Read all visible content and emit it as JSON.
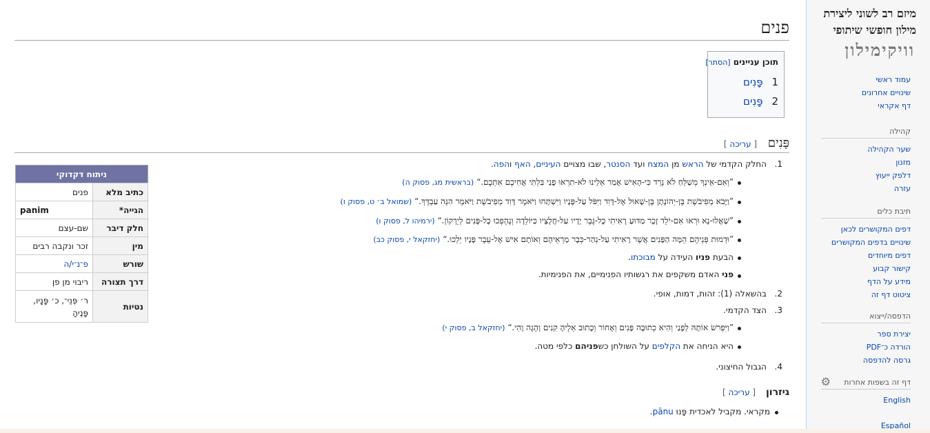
{
  "page": {
    "title": "פנים"
  },
  "toc": {
    "title": "תוכן עניינים",
    "hide_label": "[הסתר]",
    "items": [
      {
        "num": "1",
        "label": "פָּנִים"
      },
      {
        "num": "2",
        "label": "פָּנִים"
      }
    ]
  },
  "section1": {
    "heading": "פָּנִים",
    "edit_open": "[ ",
    "edit_label": "עריכה",
    "edit_close": " ]"
  },
  "def1": {
    "num": "1.",
    "text_a": "החלק הקדמי של ",
    "link_head": "הראש",
    "text_b": " מן ",
    "link_forehead": "המצח",
    "text_c": " ועד ",
    "link_chin": "הסנטר",
    "text_d": ", שבו מצויים ",
    "link_eyes": "העיניים",
    "text_e": ", ",
    "link_nose": "האף",
    "text_f": " ו",
    "link_mouth": "הפה",
    "text_g": "."
  },
  "quotes1": [
    {
      "text": "”וְאִם-אֵינְךָ מְשַׁלֵּחַ לֹא נֵרֵד כִּי-הָאִישׁ אָמַר אֵלֵינוּ לֹא-תִרְאוּ פָנַי בִּלְתִּי אֲחִיכֶם אִתְּכֶם.“",
      "source": "(בראשית מג, פסוק ה)"
    },
    {
      "text": "”וַיָּבֹא מְפִיבֹשֶׁת בֶּן-יְהוֹנָתָן בֶּן-שָׁאוּל אֶל-דָּוִד וַיִּפֹּל עַל-פָּנָיו וַיִּשְׁתָּחוּ וַיֹּאמֶר דָּוִד מְפִיבֹשֶׁת וַיֹּאמֶר הִנֵּה עַבְדֶּךָ.“",
      "source": "(שמואל ב׳ ט, פסוק ו)"
    },
    {
      "text": "”שַׁאֲלוּ-נָא וּרְאוּ אִם-יֹלֵד זָכָר מַדּוּעַ רָאִיתִי כָל-גֶּבֶר יָדָיו עַל-חֲלָצָיו כַּיּוֹלֵדָה וְנֶהֶפְכוּ כָל-פָּנִים לְיֵרָקוֹן.“",
      "source": "(ירמיהו ל, פסוק ו)"
    },
    {
      "text": "”וּדְמוּת פְּנֵיהֶם הֵמָּה הַפָּנִים אֲשֶׁר רָאִיתִי עַל-נְהַר-כְּבָר מַרְאֵיהֶם וְאוֹתָם אִישׁ אֶל-עֵבֶר פָּנָיו יֵלֵכוּ.“",
      "source": "(יחזקאל י, פסוק כב)"
    }
  ],
  "examples1": [
    {
      "bold": "פניו",
      "pre": "הבעת ",
      "rest": " העידה על ",
      "link": "מבוכתו",
      "end": "."
    },
    {
      "bold": "פני",
      "pre": "",
      "rest": " האדם משקפים את רגשותיו הפנימיים, את הפנימיות.",
      "link": "",
      "end": ""
    }
  ],
  "def2": {
    "num": "2.",
    "text": "בהשאלה (1): זהות, דמות, אופי."
  },
  "def3": {
    "num": "3.",
    "text": "הצד הקדמי."
  },
  "quote3": {
    "text": "”וַיִּפְרֹשׂ אוֹתָהּ לְפָנַי וְהִיא כְתוּבָה פָּנִים וְאָחוֹר וְכָתוּב אֵלֶיהָ קִנִים וָהֶגֶה וָהִי.“",
    "source": "(יחזקאל ב, פסוק י)"
  },
  "example3": {
    "pre": "היא הניחה את ",
    "link": "הקלפים",
    "mid": " על השולחן כש",
    "bold": "פניהם",
    "end": " כלפי מטה."
  },
  "def4": {
    "num": "4.",
    "text": "הגבול החיצוני."
  },
  "etymology": {
    "heading": "גיזרון",
    "edit_label": "עריכה",
    "text": "מקראי. מקביל לאכדית פָּנוּ ",
    "link": "pānu",
    "end": "."
  },
  "infobox": {
    "caption": "ניתוח דקדוקי",
    "rows": [
      {
        "key": "כתיב מלא",
        "value": "פנים"
      },
      {
        "key": "הגייה*",
        "value": "panim"
      },
      {
        "key": "חלק דיבר",
        "value": "שם-עצם"
      },
      {
        "key": "מין",
        "value": "זכר ונקבה רבים"
      },
      {
        "key": "שורש",
        "value": "פ־נ־י/ה"
      },
      {
        "key": "דרך תצורה",
        "value": "ריבוי מן פן"
      },
      {
        "key": "נטיות",
        "value": "ר׳ פְּנֵי־, כ׳ פָּנָיו, פָּנֶיהָ"
      }
    ]
  },
  "sidebar": {
    "logo_line1": "מיזם רב לשוני ליצירת",
    "logo_line2": "מילון חופשי שיתופי",
    "logo_word": "וויקימילון",
    "nav": [
      "עמוד ראשי",
      "שינויים אחרונים",
      "דף אקראי"
    ],
    "community": {
      "title": "קהילה",
      "items": [
        "שער הקהילה",
        "מזנון",
        "דלפק ייעוץ",
        "עזרה"
      ]
    },
    "tools": {
      "title": "תיבת כלים",
      "items": [
        "דפים המקושרים לכאן",
        "שינויים בדפים המקושרים",
        "דפים מיוחדים",
        "קישור קבוע",
        "מידע על הדף",
        "ציטוט דף זה"
      ]
    },
    "print": {
      "title": "הדפסה/ייצוא",
      "items": [
        "יצירת ספר",
        "הורדה כ־PDF",
        "גרסה להדפסה"
      ]
    },
    "languages": {
      "title": "דף זה בשפות אחרות",
      "items": [
        "English",
        "Español"
      ]
    }
  }
}
